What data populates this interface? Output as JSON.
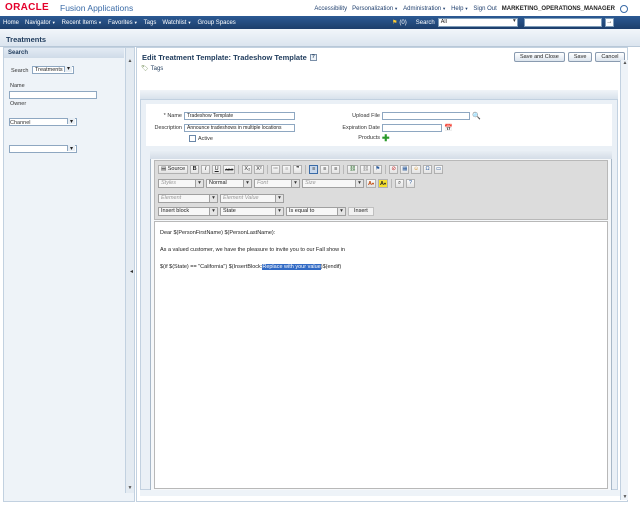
{
  "header": {
    "logo": "ORACLE",
    "product": "Fusion Applications",
    "links": [
      "Accessibility",
      "Personalization",
      "Administration",
      "Help",
      "Sign Out"
    ],
    "user": "MARKETING_OPERATIONS_MANAGER"
  },
  "navbar": {
    "items": [
      "Home",
      "Navigator",
      "Recent Items",
      "Favorites",
      "Tags",
      "Watchlist",
      "Group Spaces"
    ],
    "fav_count": "(0)",
    "search_label": "Search",
    "search_scope": "All",
    "go": "→"
  },
  "region": {
    "title": "Treatments"
  },
  "left": {
    "header": "Search",
    "search_label": "Search",
    "search_value": "Treatments",
    "name_label": "Name",
    "owner_label": "Owner",
    "channel_label": "Channel"
  },
  "main": {
    "title": "Edit Treatment Template: Tradeshow Template",
    "help": "?",
    "tags": "Tags",
    "buttons": {
      "save_close": "Save and Close",
      "save": "Save",
      "cancel": "Cancel"
    }
  },
  "form": {
    "name_label": "* Name",
    "name_value": "Tradeshow Template",
    "description_label": "Description",
    "description_value": "Announce tradeshows in multiple locations",
    "active_label": "Active",
    "upload_label": "Upload File",
    "expiration_label": "Expiration Date",
    "products_label": "Products"
  },
  "toolbar": {
    "row1": {
      "source": "Source",
      "bold": "B",
      "italic": "I",
      "underline": "U",
      "strike": "ABC",
      "sub": "X₂",
      "sup": "X²"
    },
    "styles": "Styles",
    "format": "Normal",
    "font": "Font",
    "size": "Size",
    "text_color": "A",
    "bg_color": "A",
    "element": "Element",
    "element_value": "Element Value",
    "insert_block": "Insert block",
    "state": "State",
    "condition": "Is equal to",
    "insert": "Insert"
  },
  "editor": {
    "line1": "Dear $(PersonFirstName) $(PersonLastName):",
    "line2": "As a valued customer, we have the pleasure to invite you to our Fall show in",
    "line3_prefix": "$(if $(State) == \"California\") $(InsertBlock:",
    "line3_selected": "Replace with your value",
    "line3_suffix": ")$(endif)"
  }
}
